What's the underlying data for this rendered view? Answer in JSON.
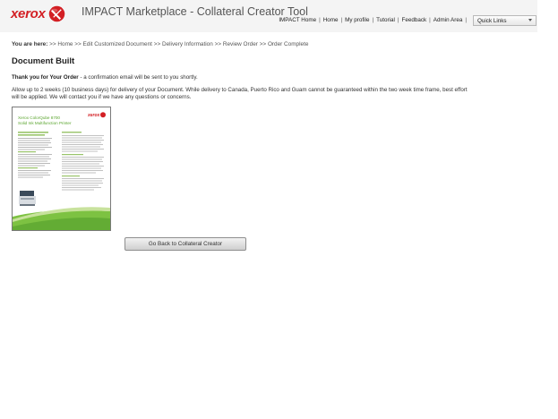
{
  "header": {
    "brand": "xerox",
    "title": "IMPACT Marketplace - Collateral Creator Tool",
    "nav": [
      "IMPACT Home",
      "Home",
      "My profile",
      "Tutorial",
      "Feedback",
      "Admin Area"
    ],
    "quick_links": "Quick Links"
  },
  "breadcrumb": {
    "lead": "You are here:",
    "items": [
      "Home",
      "Edit Customized Document",
      "Delivery Information",
      "Review Order",
      "Order Complete"
    ]
  },
  "main": {
    "title": "Document Built",
    "thanks_bold": "Thank you for Your Order",
    "thanks_rest": " - a confirmation email will be sent to you shortly.",
    "delivery_note": "Allow up to 2 weeks (10 business days) for delivery of your Document. While delivery to Canada, Puerto Rico and Guam cannot be guaranteed within the two week time frame, best effort will be applied. We will contact you if we have any questions or concerns.",
    "thumbnail": {
      "brand": "xerox",
      "heading_line1": "Xerox ColorQube 8700",
      "heading_line2": "Solid Ink Multifunction Printer"
    },
    "back_button": "Go Back to Collateral Creator"
  },
  "colors": {
    "brand_red": "#d31f24",
    "header_bg": "#f4f4f4",
    "thumb_green": "#7dc242"
  },
  "icons": [
    "xerox-logo-icon",
    "chevron-down-icon"
  ]
}
